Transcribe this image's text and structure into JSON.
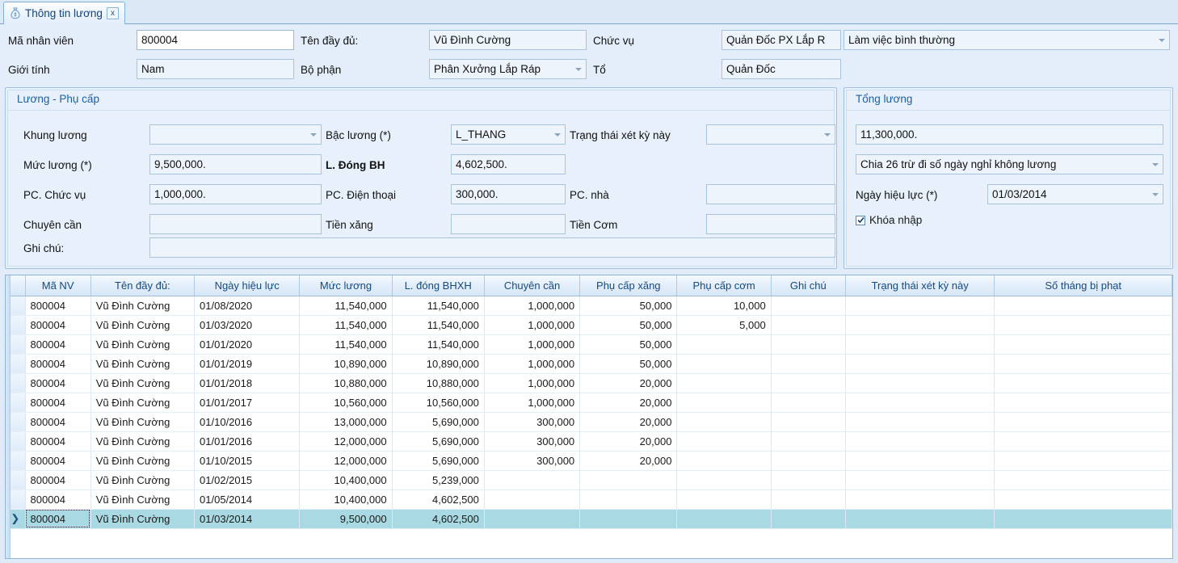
{
  "tab": {
    "label": "Thông tin lương",
    "close": "x",
    "icon": "money-bag-icon"
  },
  "topform": {
    "employee_code_label": "Mã nhân viên",
    "employee_code_value": "800004",
    "full_name_label": "Tên đầy đủ:",
    "full_name_value": "Vũ Đình Cường",
    "position_label": "Chức vụ",
    "position_value": "Quản Đốc PX Lắp R",
    "work_status_value": "Làm việc bình thường",
    "gender_label": "Giới tính",
    "gender_value": "Nam",
    "department_label": "Bộ phận",
    "department_value": "Phân Xưởng Lắp Ráp",
    "team_label": "Tổ",
    "team_value": "Quản Đốc"
  },
  "salary_group": {
    "title": "Lương - Phụ cấp",
    "salary_frame_label": "Khung lương",
    "salary_frame_value": "",
    "salary_grade_label": "Bậc lương (*)",
    "salary_grade_value": "L_THANG",
    "review_status_label": "Trạng thái xét kỳ này",
    "review_status_value": "",
    "salary_level_label": "Mức lương (*)",
    "salary_level_value": "9,500,000.",
    "insurance_label": "L. Đóng BH",
    "insurance_value": "4,602,500.",
    "pc_position_label": "PC. Chức vụ",
    "pc_position_value": "1,000,000.",
    "pc_phone_label": "PC. Điện thoại",
    "pc_phone_value": "300,000.",
    "pc_house_label": "PC. nhà",
    "pc_house_value": "",
    "diligence_label": "Chuyên cần",
    "diligence_value": "",
    "petrol_label": "Tiền xăng",
    "petrol_value": "",
    "meal_label": "Tiền Cơm",
    "meal_value": "",
    "note_label": "Ghi chú:",
    "note_value": ""
  },
  "total_group": {
    "title": "Tổng lương",
    "total_value": "11,300,000.",
    "method_value": "Chia 26 trừ đi số ngày nghỉ không lương",
    "effective_date_label": "Ngày hiệu lực (*)",
    "effective_date_value": "01/03/2014",
    "lock_label": "Khóa nhập",
    "lock_checked": true
  },
  "grid": {
    "columns": [
      "Mã NV",
      "Tên đầy đủ:",
      "Ngày hiệu lực",
      "Mức lương",
      "L. đóng BHXH",
      "Chuyên cần",
      "Phụ cấp xăng",
      "Phụ cấp cơm",
      "Ghi chú",
      "Trạng thái xét kỳ này",
      "Số tháng bị phạt"
    ],
    "rows": [
      {
        "marker": "",
        "selected": false,
        "cells": [
          "800004",
          "Vũ Đình Cường",
          "01/08/2020",
          "11,540,000",
          "11,540,000",
          "1,000,000",
          "50,000",
          "10,000",
          "",
          "",
          ""
        ]
      },
      {
        "marker": "",
        "selected": false,
        "cells": [
          "800004",
          "Vũ Đình Cường",
          "01/03/2020",
          "11,540,000",
          "11,540,000",
          "1,000,000",
          "50,000",
          "5,000",
          "",
          "",
          ""
        ]
      },
      {
        "marker": "",
        "selected": false,
        "cells": [
          "800004",
          "Vũ Đình Cường",
          "01/01/2020",
          "11,540,000",
          "11,540,000",
          "1,000,000",
          "50,000",
          "",
          "",
          "",
          ""
        ]
      },
      {
        "marker": "",
        "selected": false,
        "cells": [
          "800004",
          "Vũ Đình Cường",
          "01/01/2019",
          "10,890,000",
          "10,890,000",
          "1,000,000",
          "50,000",
          "",
          "",
          "",
          ""
        ]
      },
      {
        "marker": "",
        "selected": false,
        "cells": [
          "800004",
          "Vũ Đình Cường",
          "01/01/2018",
          "10,880,000",
          "10,880,000",
          "1,000,000",
          "20,000",
          "",
          "",
          "",
          ""
        ]
      },
      {
        "marker": "",
        "selected": false,
        "cells": [
          "800004",
          "Vũ Đình Cường",
          "01/01/2017",
          "10,560,000",
          "10,560,000",
          "1,000,000",
          "20,000",
          "",
          "",
          "",
          ""
        ]
      },
      {
        "marker": "",
        "selected": false,
        "cells": [
          "800004",
          "Vũ Đình Cường",
          "01/10/2016",
          "13,000,000",
          "5,690,000",
          "300,000",
          "20,000",
          "",
          "",
          "",
          ""
        ]
      },
      {
        "marker": "",
        "selected": false,
        "cells": [
          "800004",
          "Vũ Đình Cường",
          "01/01/2016",
          "12,000,000",
          "5,690,000",
          "300,000",
          "20,000",
          "",
          "",
          "",
          ""
        ]
      },
      {
        "marker": "",
        "selected": false,
        "cells": [
          "800004",
          "Vũ Đình Cường",
          "01/10/2015",
          "12,000,000",
          "5,690,000",
          "300,000",
          "20,000",
          "",
          "",
          "",
          ""
        ]
      },
      {
        "marker": "",
        "selected": false,
        "cells": [
          "800004",
          "Vũ Đình Cường",
          "01/02/2015",
          "10,400,000",
          "5,239,000",
          "",
          "",
          "",
          "",
          "",
          ""
        ]
      },
      {
        "marker": "",
        "selected": false,
        "cells": [
          "800004",
          "Vũ Đình Cường",
          "01/05/2014",
          "10,400,000",
          "4,602,500",
          "",
          "",
          "",
          "",
          "",
          ""
        ]
      },
      {
        "marker": "❯",
        "selected": true,
        "cells": [
          "800004",
          "Vũ Đình Cường",
          "01/03/2014",
          "9,500,000",
          "4,602,500",
          "",
          "",
          "",
          "",
          "",
          ""
        ]
      }
    ]
  },
  "colors": {
    "accent": "#1b5fa8",
    "selection": "#a9d9e2",
    "panel": "#e8f1fb",
    "border": "#9fc0e0"
  }
}
